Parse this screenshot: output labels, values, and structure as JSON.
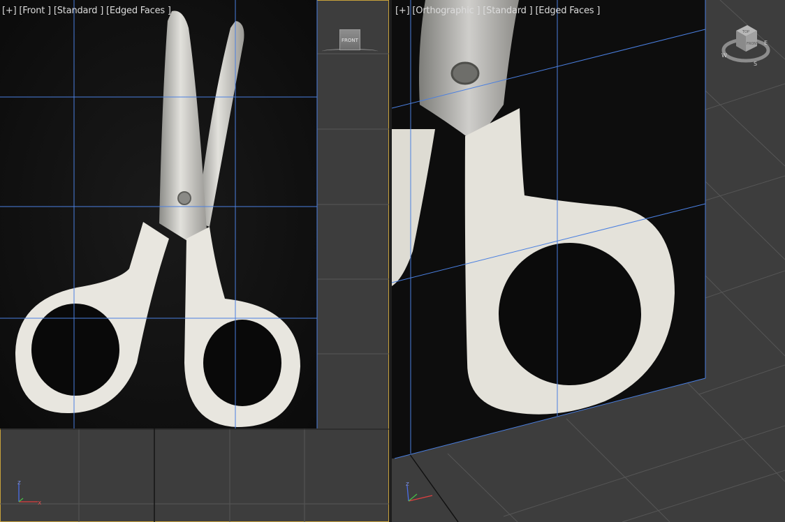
{
  "viewports": {
    "front": {
      "label_plus": "[+]",
      "label_view": "[Front ]",
      "label_shading": "[Standard ]",
      "label_edges": "[Edged Faces ]",
      "viewcube_face": "FRONT"
    },
    "ortho": {
      "label_plus": "[+]",
      "label_view": "[Orthographic ]",
      "label_shading": "[Standard ]",
      "label_edges": "[Edged Faces ]",
      "viewcube_top": "TOP",
      "viewcube_front": "FRONT",
      "compass_w": "W",
      "compass_s": "S",
      "compass_e": "E"
    }
  },
  "axis_labels": {
    "z": "z",
    "x": "x"
  },
  "icons": [
    "viewcube-icon",
    "axis-tripod-icon",
    "compass-ring-icon"
  ],
  "colors": {
    "viewport_bg": "#3d3d3d",
    "active_border": "#c8a23c",
    "grid": "#5a5a5a",
    "edge_wire": "#4a7fe0",
    "handle_white": "#e8e6df",
    "blade_steel": "#c7c7c4"
  }
}
